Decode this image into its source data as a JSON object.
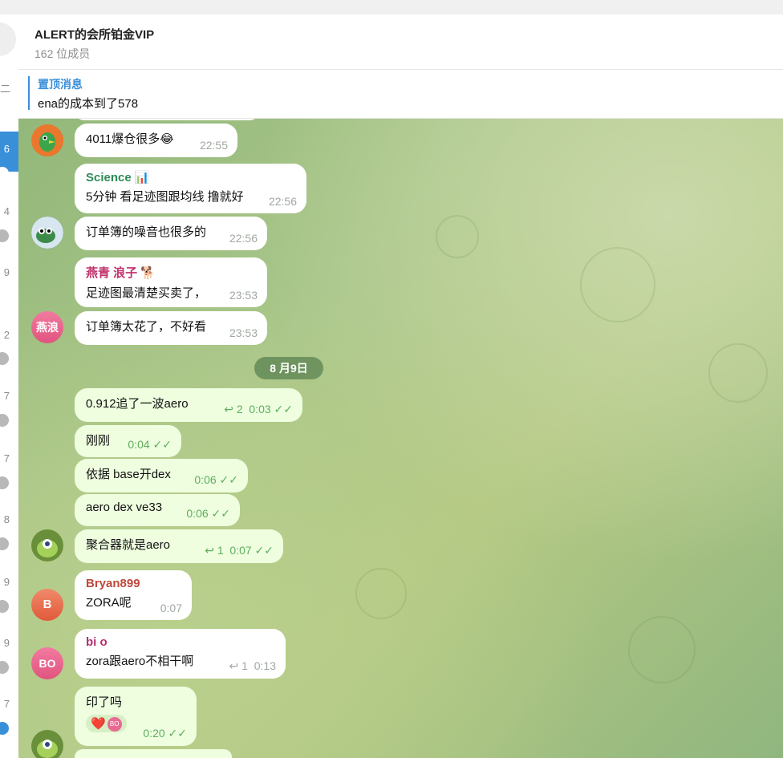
{
  "header": {
    "title": "ALERT的会所铂金VIP",
    "subtitle": "162 位成员"
  },
  "pinned": {
    "label": "置顶消息",
    "text": "ena的成本到了578"
  },
  "left_rail": {
    "nums": [
      "二",
      "6",
      "4",
      "9",
      "2",
      "7",
      "7",
      "8",
      "9",
      "9",
      "7"
    ]
  },
  "date_divider": "8 月9日",
  "messages": [
    {
      "sender": "",
      "text": "4011爆仓很多😂",
      "time": "22:55",
      "replies": "",
      "avatar": ""
    },
    {
      "sender": "Science 📊",
      "text": "5分钟 看足迹图跟均线 撸就好",
      "time": "22:56",
      "replies": "",
      "avatar": ""
    },
    {
      "sender": "",
      "text": "订单簿的噪音也很多的",
      "time": "22:56",
      "replies": "",
      "avatar": ""
    },
    {
      "sender": "燕青 浪子 🐕",
      "text": "足迹图最清楚买卖了，",
      "time": "23:53",
      "replies": "",
      "avatar": ""
    },
    {
      "sender": "",
      "text": "订单簿太花了，不好看",
      "time": "23:53",
      "replies": "",
      "avatar": "燕浪"
    },
    {
      "sender": "",
      "text": "0.912追了一波aero",
      "time": "0:03",
      "replies": "2",
      "avatar": ""
    },
    {
      "sender": "",
      "text": "刚刚",
      "time": "0:04",
      "replies": "",
      "avatar": ""
    },
    {
      "sender": "",
      "text": "依据 base开dex",
      "time": "0:06",
      "replies": "",
      "avatar": ""
    },
    {
      "sender": "",
      "text": "aero dex ve33",
      "time": "0:06",
      "replies": "",
      "avatar": ""
    },
    {
      "sender": "",
      "text": "聚合器就是aero",
      "time": "0:07",
      "replies": "1",
      "avatar": ""
    },
    {
      "sender": "Bryan899",
      "text": "ZORA呢",
      "time": "0:07",
      "replies": "",
      "avatar": "B"
    },
    {
      "sender": "bi o",
      "text": "zora跟aero不相干啊",
      "time": "0:13",
      "replies": "1",
      "avatar": "BO"
    },
    {
      "sender": "",
      "text": "印了吗",
      "time": "0:20",
      "replies": "",
      "avatar": ""
    }
  ],
  "reaction": {
    "emoji": "❤️",
    "avatar": "BO"
  },
  "icons": {
    "reply": "reply-arrow-icon",
    "read": "double-check-icon"
  },
  "colors": {
    "accent": "#3a8fd9",
    "science": "#2e8b57",
    "yan": "#c0306a",
    "bryan": "#c0473a",
    "bio": "#b4306e",
    "outgoing": "#eefedf"
  }
}
